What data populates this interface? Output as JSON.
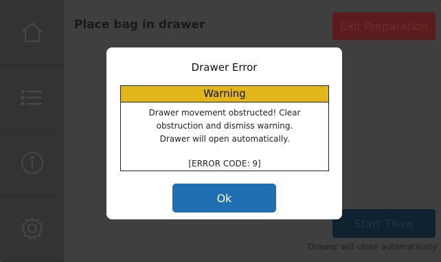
{
  "sidebar": {
    "items": [
      {
        "label": "Home",
        "icon": "home-icon"
      },
      {
        "label": "List",
        "icon": "list-icon"
      },
      {
        "label": "Info",
        "icon": "info-icon"
      },
      {
        "label": "Settings",
        "icon": "gear-icon"
      }
    ]
  },
  "main": {
    "title": "Place bag in drawer",
    "exit_button": "Exit Preparation",
    "start_button": "Start Thaw",
    "auto_close_text": "Drawer will close automatically"
  },
  "dialog": {
    "title": "Drawer Error",
    "warning_header": "Warning",
    "message_lines": [
      "Drawer movement obstructed! Clear",
      "obstruction and dismiss warning.",
      "Drawer will open automatically."
    ],
    "error_code": "[ERROR CODE: 9]",
    "ok_button": "Ok"
  },
  "colors": {
    "warning_header": "#e1b61b",
    "ok_button": "#1f6fb2",
    "exit_button": "#5a1c1c",
    "start_button": "#0e2230"
  }
}
